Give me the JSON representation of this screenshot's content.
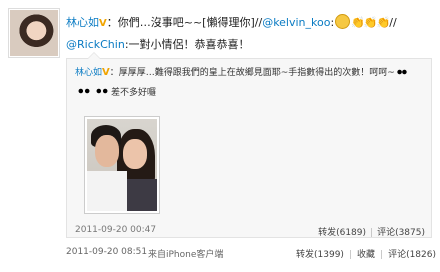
{
  "post": {
    "author": "林心如",
    "text1_pre": "：你們…沒事吧~~[懶得理你]//",
    "mention1": "@kelvin_koo",
    "text1_post": ":",
    "text1_tail": "//",
    "mention2": "@RickChin",
    "text2": ":一對小情侶！恭喜恭喜！",
    "time": "2011-09-20 08:51",
    "source": "来自iPhone客户端",
    "repost_label": "转发(1399)",
    "favorite_label": "收藏",
    "comment_label": "评论(1826)"
  },
  "repost": {
    "author": "林心如",
    "text_line1": "：厚厚厚…難得跟我們的皇上在故鄉見面耶~手指數得出的次數！呵呵~",
    "text_line2": "差不多好囉",
    "time": "2011-09-20 00:47",
    "repost_label": "转发(6189)",
    "comment_label": "评论(3875)"
  },
  "icons": {
    "verified": "V",
    "clap": "👏👏👏"
  },
  "colors": {
    "link": "#0a7bc3",
    "verified": "#f0a400"
  }
}
